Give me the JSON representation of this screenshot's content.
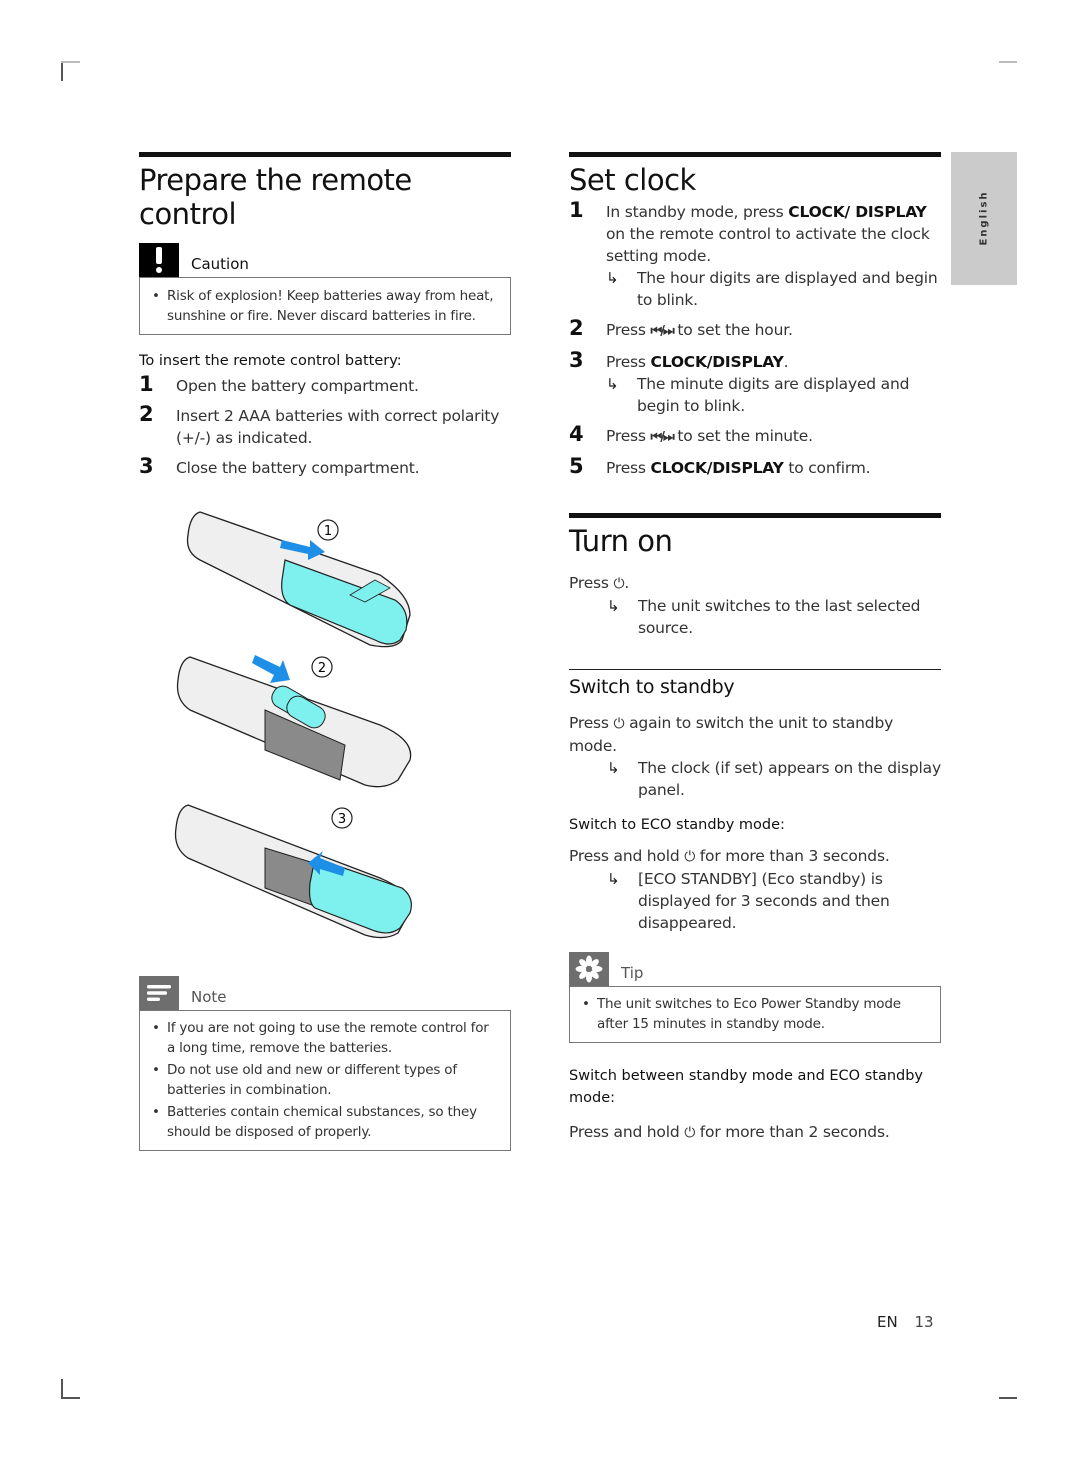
{
  "page": {
    "language_tab": "English",
    "footer": {
      "lang": "EN",
      "page_number": "13"
    }
  },
  "prepare_remote": {
    "title": "Prepare the remote control",
    "caution": {
      "label": "Caution",
      "icon": "exclamation-icon",
      "items": [
        "Risk of explosion! Keep batteries away from heat, sunshine or fire. Never discard batteries in fire."
      ]
    },
    "intro": "To insert the remote control battery:",
    "steps": [
      {
        "num": "1",
        "text": "Open the battery compartment."
      },
      {
        "num": "2",
        "text": "Insert 2 AAA batteries with correct polarity (+/-) as indicated."
      },
      {
        "num": "3",
        "text": "Close the battery compartment."
      }
    ],
    "figure_labels": [
      "1",
      "2",
      "3"
    ],
    "figure_colors": {
      "cover": "#7ef0ee",
      "arrow": "#1e8fe6",
      "body": "#efefef",
      "shadow": "#8a8a8a"
    },
    "note": {
      "label": "Note",
      "icon": "note-lines-icon",
      "items": [
        "If you are not going to use the remote control for a long time, remove the batteries.",
        "Do not use old and new or different types of batteries in combination.",
        "Batteries contain chemical substances, so they should be disposed of properly."
      ]
    }
  },
  "set_clock": {
    "title": "Set clock",
    "steps": [
      {
        "num": "1",
        "pre": "In standby mode, press ",
        "bold": "CLOCK/ DISPLAY",
        "post": " on the remote control to activate the clock setting mode.",
        "result": "The hour digits are displayed and begin to blink."
      },
      {
        "num": "2",
        "pre": "Press ",
        "icon": "prev-next-icon",
        "icon_text": "⏮/⏭",
        "post": " to set the hour."
      },
      {
        "num": "3",
        "pre": "Press ",
        "bold": "CLOCK/DISPLAY",
        "post": ".",
        "result": "The minute digits are displayed and begin to blink."
      },
      {
        "num": "4",
        "pre": "Press ",
        "icon": "prev-next-icon",
        "icon_text": "⏮/⏭",
        "post": " to set the minute."
      },
      {
        "num": "5",
        "pre": "Press ",
        "bold": "CLOCK/DISPLAY",
        "post": " to confirm."
      }
    ]
  },
  "turn_on": {
    "title": "Turn on",
    "press_pre": "Press ",
    "power_icon": "⏻",
    "press_post": ".",
    "result": "The unit switches to the last selected source."
  },
  "standby": {
    "title": "Switch to standby",
    "text_pre": "Press ",
    "text_post": " again to switch the unit to standby mode.",
    "result": "The clock (if set) appears on the display panel.",
    "eco_heading": "Switch to ECO standby mode:",
    "eco_pre": "Press and hold ",
    "eco_post": " for more than 3 seconds.",
    "eco_result": "[ECO STANDBY] (Eco standby) is displayed for 3 seconds and then disappeared.",
    "tip": {
      "label": "Tip",
      "icon": "asterisk-tip-icon",
      "items": [
        "The unit switches to Eco Power Standby mode after 15 minutes in standby mode."
      ]
    },
    "between_heading": "Switch between standby mode and ECO standby mode:",
    "between_pre": "Press and hold ",
    "between_post": " for more than 2 seconds.",
    "power_icon": "⏻",
    "arrow": "↳"
  }
}
